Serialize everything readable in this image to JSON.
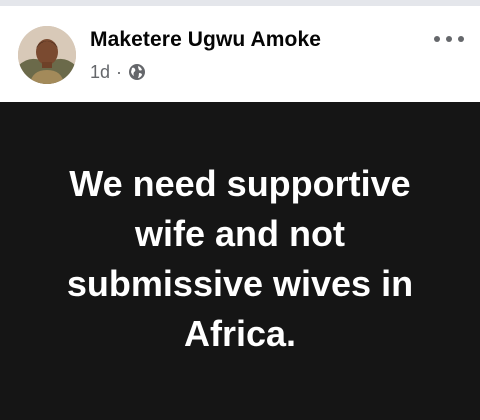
{
  "post": {
    "author": "Maketere Ugwu Amoke",
    "time": "1d",
    "separator": "·",
    "privacy_icon": "globe-icon",
    "menu_icon": "more-options-icon",
    "text_lines": [
      "We need supportive",
      "wife and not",
      "submissive wives in",
      "Africa."
    ]
  },
  "colors": {
    "post_background": "#151515",
    "post_text": "#ffffff",
    "name": "#050505",
    "meta": "#65676b"
  }
}
